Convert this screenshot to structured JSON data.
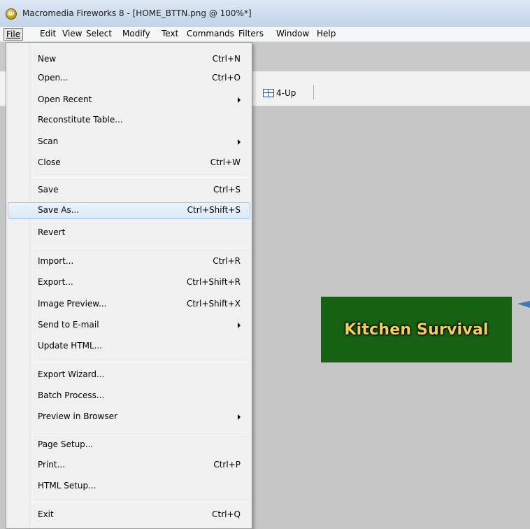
{
  "window": {
    "title": "Macromedia Fireworks 8 - [HOME_BTTN.png @ 100%*]",
    "app_icon": "fw-logo-icon",
    "app_icon_glyph": "ω"
  },
  "menubar": {
    "items": [
      {
        "label": "File",
        "active": true
      },
      {
        "label": "Edit"
      },
      {
        "label": "View"
      },
      {
        "label": "Select"
      },
      {
        "label": "Modify"
      },
      {
        "label": "Text"
      },
      {
        "label": "Commands"
      },
      {
        "label": "Filters"
      },
      {
        "label": "Window"
      },
      {
        "label": "Help"
      }
    ]
  },
  "toolbar": {
    "fourup_label": "4-Up",
    "fourup_icon": "grid-icon"
  },
  "canvas": {
    "banner_text": "Kitchen Survival",
    "banner_bg": "#176112",
    "banner_text_color": "#f3cf5a"
  },
  "file_menu": {
    "items": [
      {
        "label": "New",
        "shortcut": "Ctrl+N"
      },
      {
        "label": "Open...",
        "shortcut": "Ctrl+O"
      },
      {
        "label": "Open Recent",
        "submenu": true
      },
      {
        "label": "Reconstitute Table..."
      },
      {
        "label": "Scan",
        "submenu": true
      },
      {
        "label": "Close",
        "shortcut": "Ctrl+W"
      },
      {
        "label": "Save",
        "shortcut": "Ctrl+S"
      },
      {
        "label": "Save As...",
        "shortcut": "Ctrl+Shift+S",
        "highlighted": true
      },
      {
        "label": "Revert"
      },
      {
        "label": "Import...",
        "shortcut": "Ctrl+R"
      },
      {
        "label": "Export...",
        "shortcut": "Ctrl+Shift+R"
      },
      {
        "label": "Image Preview...",
        "shortcut": "Ctrl+Shift+X"
      },
      {
        "label": "Send to E-mail",
        "submenu": true
      },
      {
        "label": "Update HTML..."
      },
      {
        "label": "Export Wizard..."
      },
      {
        "label": "Batch Process..."
      },
      {
        "label": "Preview in Browser",
        "submenu": true
      },
      {
        "label": "Page Setup..."
      },
      {
        "label": "Print...",
        "shortcut": "Ctrl+P"
      },
      {
        "label": "HTML Setup..."
      },
      {
        "label": "Exit",
        "shortcut": "Ctrl+Q"
      }
    ]
  },
  "colors": {
    "menu_highlight_border": "#a8c8ec",
    "canvas_bg": "#c6c6c6"
  }
}
